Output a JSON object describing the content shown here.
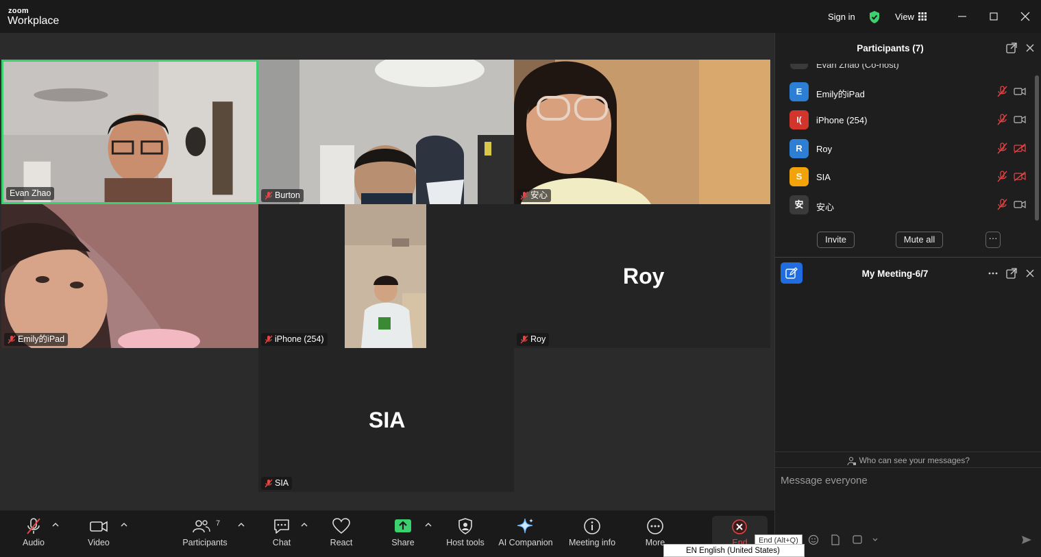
{
  "titlebar": {
    "logo_top": "zoom",
    "logo_bottom": "Workplace",
    "sign_in": "Sign in",
    "view": "View",
    "accent_green": "#3bd16f"
  },
  "tiles": [
    {
      "name": "Evan Zhao",
      "muted": false,
      "video": true,
      "active_speaker": true
    },
    {
      "name": "Burton",
      "muted": true,
      "video": true
    },
    {
      "name": "安心",
      "muted": true,
      "video": true
    },
    {
      "name": "Emily的iPad",
      "muted": true,
      "video": true
    },
    {
      "name": "iPhone (254)",
      "muted": true,
      "video": true
    },
    {
      "name": "Roy",
      "muted": true,
      "video": false,
      "big_label": "Roy"
    },
    {
      "name": "SIA",
      "muted": true,
      "video": false,
      "big_label": "SIA"
    }
  ],
  "toolbar": {
    "audio": "Audio",
    "video": "Video",
    "participants": "Participants",
    "participants_count": "7",
    "chat": "Chat",
    "react": "React",
    "share": "Share",
    "host_tools": "Host tools",
    "ai_companion": "AI Companion",
    "meeting_info": "Meeting info",
    "more": "More",
    "end": "End",
    "end_tooltip": "End (Alt+Q)",
    "language": "EN English (United States)"
  },
  "participants_panel": {
    "title": "Participants (7)",
    "partial_row": "Evan Zhao (Co-host)",
    "rows": [
      {
        "initial": "E",
        "name": "Emily的iPad",
        "color": "#2d7fd6",
        "video_off": false
      },
      {
        "initial": "I(",
        "name": "iPhone (254)",
        "color": "#d2352b",
        "video_off": false
      },
      {
        "initial": "R",
        "name": "Roy",
        "color": "#2d7fd6",
        "video_off": true
      },
      {
        "initial": "S",
        "name": "SIA",
        "color": "#f2a30c",
        "video_off": true
      },
      {
        "initial": "安",
        "name": "安心",
        "color": "#3a3a3a",
        "video_off": false
      }
    ],
    "invite": "Invite",
    "mute_all": "Mute all",
    "more": "···"
  },
  "chat_panel": {
    "title": "My Meeting-6/7",
    "who_can_see": "Who can see your messages?",
    "placeholder": "Message everyone"
  }
}
